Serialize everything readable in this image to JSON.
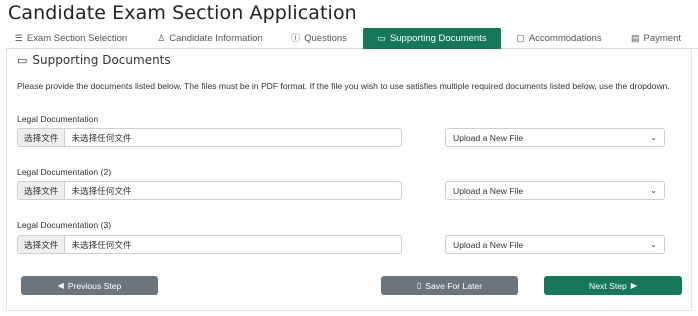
{
  "page": {
    "title": "Candidate Exam Section Application"
  },
  "tabs": [
    {
      "label": "Exam Section Selection",
      "icon": "list-icon",
      "glyph": "☰",
      "active": false
    },
    {
      "label": "Candidate Information",
      "icon": "person-icon",
      "glyph": "♙",
      "active": false
    },
    {
      "label": "Questions",
      "icon": "question-circle-icon",
      "glyph": "ⓘ",
      "active": false
    },
    {
      "label": "Supporting Documents",
      "icon": "folder-icon",
      "glyph": "▭",
      "active": true
    },
    {
      "label": "Accommodations",
      "icon": "clipboard-icon",
      "glyph": "▢",
      "active": false
    },
    {
      "label": "Payment",
      "icon": "card-icon",
      "glyph": "▤",
      "active": false
    }
  ],
  "section": {
    "title": "Supporting Documents",
    "icon": "folder-icon",
    "glyph": "▭",
    "instructions": "Please provide the documents listed below. The files must be in PDF format. If the file you wish to use satisfies multiple required documents listed below, use the dropdown."
  },
  "documents": [
    {
      "label": "Legal Documentation",
      "file_button": "选择文件",
      "file_status": "未选择任何文件",
      "select_value": "Upload a New File"
    },
    {
      "label": "Legal Documentation (2)",
      "file_button": "选择文件",
      "file_status": "未选择任何文件",
      "select_value": "Upload a New File"
    },
    {
      "label": "Legal Documentation (3)",
      "file_button": "选择文件",
      "file_status": "未选择任何文件",
      "select_value": "Upload a New File"
    }
  ],
  "actions": {
    "previous": "Previous Step",
    "save": "Save For Later",
    "next": "Next Step"
  },
  "colors": {
    "accent": "#17775a",
    "secondary": "#6c757d"
  }
}
